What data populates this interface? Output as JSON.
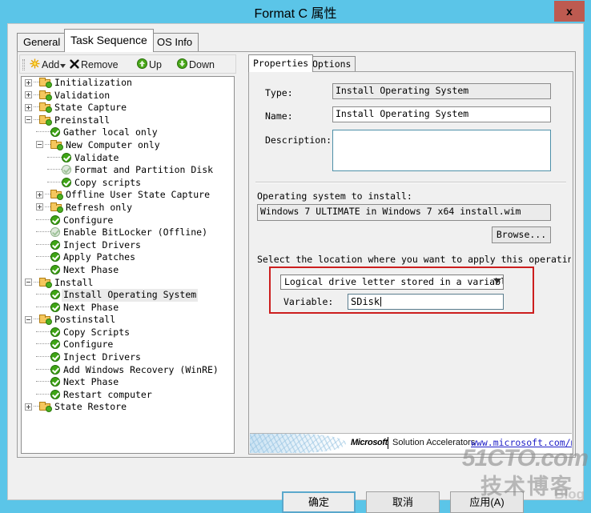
{
  "window": {
    "title": "Format C 属性",
    "close_label": "x",
    "titlebar_color": "#5bc5e8",
    "close_color": "#bd5a50"
  },
  "outer_tabs": [
    {
      "label": "General",
      "active": false
    },
    {
      "label": "Task Sequence",
      "active": true
    },
    {
      "label": "OS Info",
      "active": false
    }
  ],
  "toolbar": {
    "add_label": "Add",
    "add_icon": "sunburst-icon",
    "add_dropdown_icon": "caret-down-icon",
    "remove_label": "Remove",
    "remove_icon": "x-cross-icon",
    "up_label": "Up",
    "up_icon": "green-arrow-up-icon",
    "down_label": "Down",
    "down_icon": "green-arrow-down-icon"
  },
  "tree": [
    {
      "label": "Initialization",
      "depth": 0,
      "icon": "folder",
      "expander": "plus",
      "selected": false
    },
    {
      "label": "Validation",
      "depth": 0,
      "icon": "folder",
      "expander": "plus",
      "selected": false
    },
    {
      "label": "State Capture",
      "depth": 0,
      "icon": "folder",
      "expander": "plus",
      "selected": false
    },
    {
      "label": "Preinstall",
      "depth": 0,
      "icon": "folder",
      "expander": "minus",
      "selected": false
    },
    {
      "label": "Gather local only",
      "depth": 1,
      "icon": "check",
      "expander": "none",
      "selected": false
    },
    {
      "label": "New Computer only",
      "depth": 1,
      "icon": "folder",
      "expander": "minus",
      "selected": false
    },
    {
      "label": "Validate",
      "depth": 2,
      "icon": "check",
      "expander": "none",
      "selected": false
    },
    {
      "label": "Format and Partition Disk",
      "depth": 2,
      "icon": "check-dim",
      "expander": "none",
      "selected": false
    },
    {
      "label": "Copy scripts",
      "depth": 2,
      "icon": "check",
      "expander": "none",
      "selected": false
    },
    {
      "label": "Offline User State Capture",
      "depth": 1,
      "icon": "folder",
      "expander": "plus",
      "selected": false
    },
    {
      "label": "Refresh only",
      "depth": 1,
      "icon": "folder",
      "expander": "plus",
      "selected": false
    },
    {
      "label": "Configure",
      "depth": 1,
      "icon": "check",
      "expander": "none",
      "selected": false
    },
    {
      "label": "Enable BitLocker (Offline)",
      "depth": 1,
      "icon": "check-dim",
      "expander": "none",
      "selected": false
    },
    {
      "label": "Inject Drivers",
      "depth": 1,
      "icon": "check",
      "expander": "none",
      "selected": false
    },
    {
      "label": "Apply Patches",
      "depth": 1,
      "icon": "check",
      "expander": "none",
      "selected": false
    },
    {
      "label": "Next Phase",
      "depth": 1,
      "icon": "check",
      "expander": "none",
      "selected": false
    },
    {
      "label": "Install",
      "depth": 0,
      "icon": "folder",
      "expander": "minus",
      "selected": false
    },
    {
      "label": "Install Operating System",
      "depth": 1,
      "icon": "check",
      "expander": "none",
      "selected": true
    },
    {
      "label": "Next Phase",
      "depth": 1,
      "icon": "check",
      "expander": "none",
      "selected": false
    },
    {
      "label": "Postinstall",
      "depth": 0,
      "icon": "folder",
      "expander": "minus",
      "selected": false
    },
    {
      "label": "Copy Scripts",
      "depth": 1,
      "icon": "check",
      "expander": "none",
      "selected": false
    },
    {
      "label": "Configure",
      "depth": 1,
      "icon": "check",
      "expander": "none",
      "selected": false
    },
    {
      "label": "Inject Drivers",
      "depth": 1,
      "icon": "check",
      "expander": "none",
      "selected": false
    },
    {
      "label": "Add Windows Recovery (WinRE)",
      "depth": 1,
      "icon": "check",
      "expander": "none",
      "selected": false
    },
    {
      "label": "Next Phase",
      "depth": 1,
      "icon": "check",
      "expander": "none",
      "selected": false
    },
    {
      "label": "Restart computer",
      "depth": 1,
      "icon": "check",
      "expander": "none",
      "selected": false
    },
    {
      "label": "State Restore",
      "depth": 0,
      "icon": "folder",
      "expander": "plus",
      "selected": false
    }
  ],
  "inner_tabs": [
    {
      "label": "Properties",
      "active": true
    },
    {
      "label": "Options",
      "active": false
    }
  ],
  "properties": {
    "type_label": "Type:",
    "type_value": "Install Operating System",
    "name_label": "Name:",
    "name_value": "Install Operating System",
    "description_label": "Description:",
    "description_value": "",
    "os_to_install_label": "Operating system to install:",
    "os_to_install_value": "Windows 7 ULTIMATE in Windows 7 x64 install.wim",
    "browse_label": "Browse...",
    "location_label": "Select the location where you want to apply this operating syster",
    "location_select_value": "Logical drive letter stored in a variable",
    "location_select_icon": "chevron-down-icon",
    "variable_label": "Variable:",
    "variable_value": "SDisk"
  },
  "footer": {
    "brand": "Microsoft",
    "tagline": "Solution Accelerators",
    "url": "www.microsoft.com/mdt"
  },
  "dialog_buttons": {
    "ok": "确定",
    "cancel": "取消",
    "apply": "应用(A)"
  },
  "watermark": {
    "line1": "51CTO.com",
    "line2": "技术博客",
    "line3": "Blog"
  }
}
